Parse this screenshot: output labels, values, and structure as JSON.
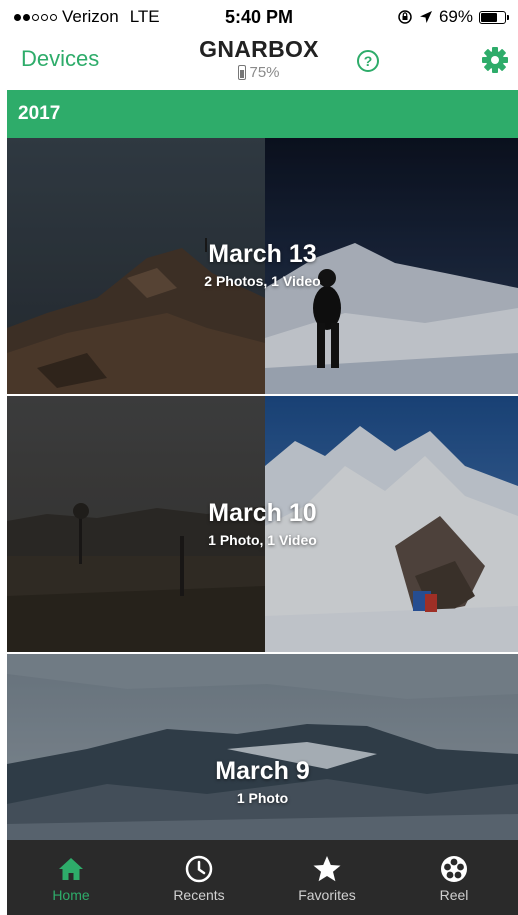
{
  "status_bar": {
    "carrier": "Verizon",
    "network": "LTE",
    "time": "5:40 PM",
    "battery_percent": "69%",
    "battery_level": 0.69,
    "signal_bars_filled": 2,
    "signal_bars_total": 5
  },
  "nav": {
    "back_label": "Devices",
    "title": "GNARBOX",
    "device_battery": "75%",
    "device_battery_level": 0.75,
    "help_glyph": "?",
    "help_icon": "question-circle-icon",
    "settings_icon": "gear-icon"
  },
  "year_header": "2017",
  "days": [
    {
      "date": "March 13",
      "count": "2 Photos, 1 Video"
    },
    {
      "date": "March 10",
      "count": "1 Photo, 1 Video"
    },
    {
      "date": "March 9",
      "count": "1 Photo"
    }
  ],
  "tabs": [
    {
      "label": "Home",
      "icon": "home-icon",
      "active": true
    },
    {
      "label": "Recents",
      "icon": "clock-icon",
      "active": false
    },
    {
      "label": "Favorites",
      "icon": "star-icon",
      "active": false
    },
    {
      "label": "Reel",
      "icon": "film-reel-icon",
      "active": false
    }
  ],
  "colors": {
    "accent": "#2eac6a",
    "tab_bar": "#2a2a2a",
    "tab_inactive": "#d0d0d0"
  }
}
